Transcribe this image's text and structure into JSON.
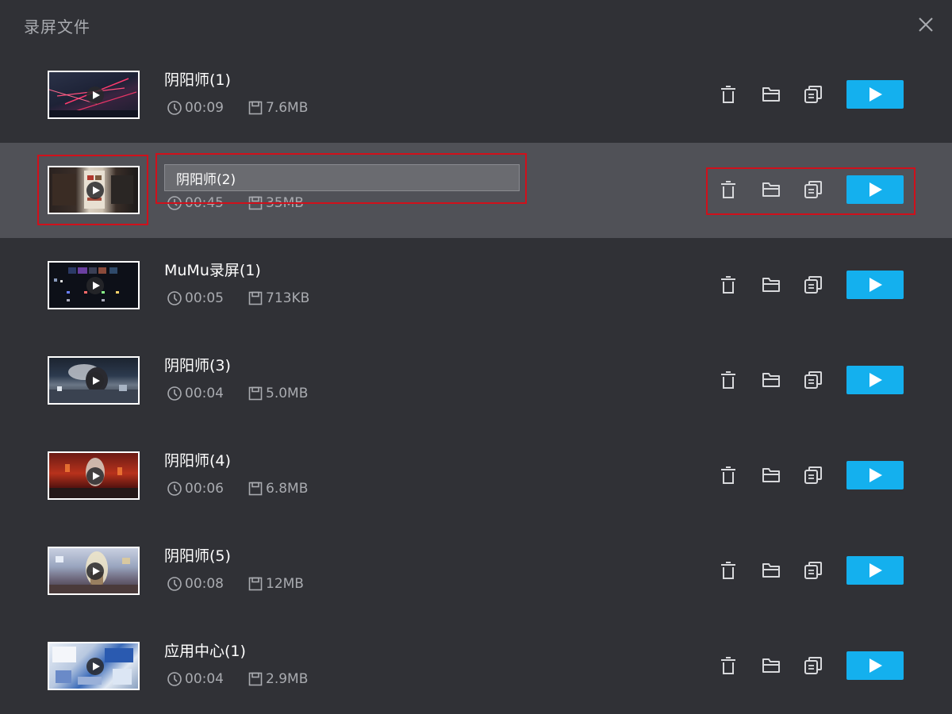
{
  "window": {
    "title": "录屏文件"
  },
  "colors": {
    "background": "#303136",
    "selected_row": "#505157",
    "accent": "#14b0ee",
    "highlight_box": "#d0101b"
  },
  "recordings": [
    {
      "name": "阴阳师(1)",
      "duration": "00:09",
      "size": "7.6MB"
    },
    {
      "name": "阴阳师(2)",
      "duration": "00:45",
      "size": "35MB",
      "editing": true,
      "input_value": "阴阳师(2)"
    },
    {
      "name": "MuMu录屏(1)",
      "duration": "00:05",
      "size": "713KB"
    },
    {
      "name": "阴阳师(3)",
      "duration": "00:04",
      "size": "5.0MB"
    },
    {
      "name": "阴阳师(4)",
      "duration": "00:06",
      "size": "6.8MB"
    },
    {
      "name": "阴阳师(5)",
      "duration": "00:08",
      "size": "12MB"
    },
    {
      "name": "应用中心(1)",
      "duration": "00:04",
      "size": "2.9MB"
    }
  ],
  "icons": {
    "close": "close-icon",
    "duration": "clock-icon",
    "size": "disk-icon",
    "delete": "trash-icon",
    "open_folder": "folder-icon",
    "copy": "copy-icon",
    "play": "play-icon"
  }
}
